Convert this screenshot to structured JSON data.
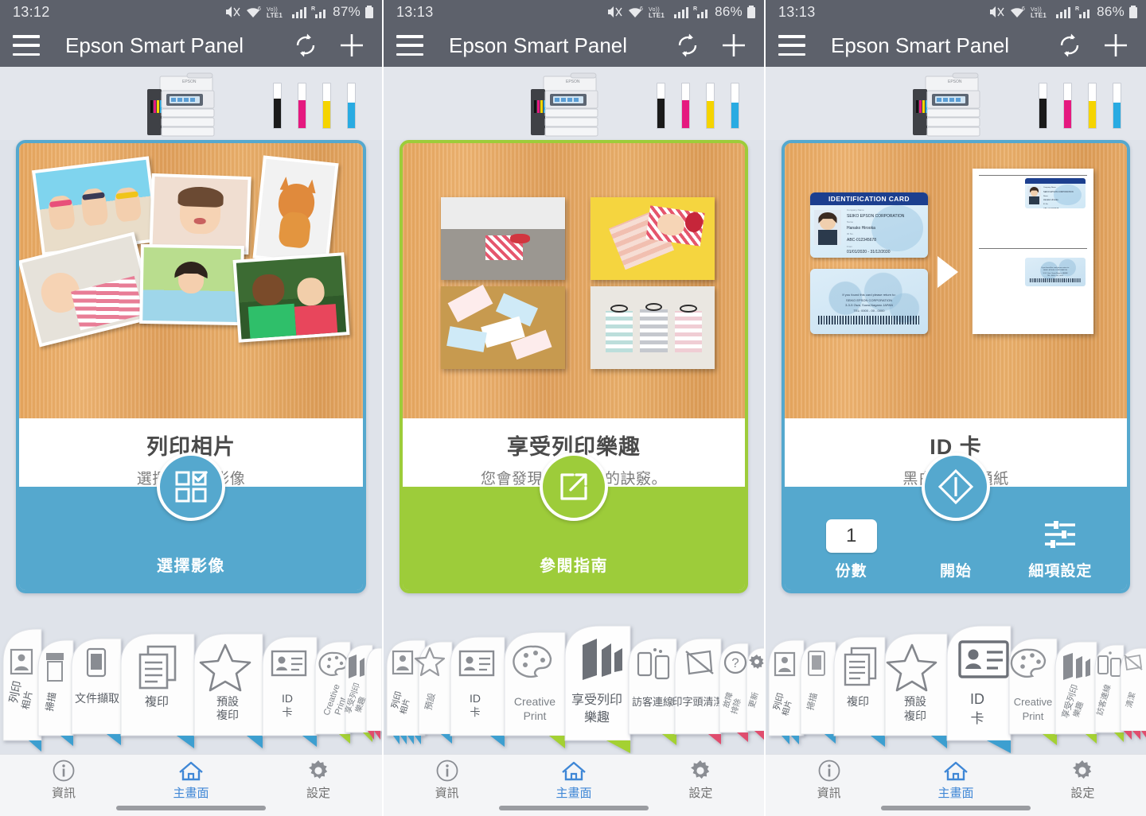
{
  "panels": [
    {
      "status": {
        "time": "13:12",
        "battery": "87%",
        "network": "LTE1",
        "voice": "Vo)) ",
        "mute_icon": "mute-icon",
        "wifi_icon": "wifi-icon",
        "signal_icon": "signal-icon",
        "battery_icon": "battery-icon"
      },
      "appbar": {
        "menu_icon": "hamburger-menu-icon",
        "title": "Epson Smart Panel",
        "refresh_icon": "refresh-icon",
        "add_icon": "plus-icon"
      },
      "printer": {
        "brand": "EPSON",
        "ink_colors": [
          "#1a1a1a",
          "#e5197f",
          "#f5d400",
          "#29abe2"
        ]
      },
      "card": {
        "accent": "#55a8ce",
        "title": "列印相片",
        "subtitle": "選擇並列印影像",
        "action_icon": "select-images-grid-icon",
        "action_label": "選擇影像"
      },
      "carousel": [
        {
          "label_lines": [
            "列印",
            "相片"
          ],
          "icon": "photo-print-icon",
          "tab_color": "#3c9fd0",
          "state": "far-left"
        },
        {
          "label_lines": [
            "掃描"
          ],
          "icon": "scan-icon",
          "tab_color": "#3c9fd0",
          "state": "small"
        },
        {
          "label_lines": [
            "文件擷取"
          ],
          "icon": "document-capture-icon",
          "tab_color": "#3c9fd0",
          "state": "small"
        },
        {
          "label_lines": [
            "複印"
          ],
          "icon": "copy-icon",
          "tab_color": "#3c9fd0",
          "state": "normal"
        },
        {
          "label_lines": [
            "預設",
            "複印"
          ],
          "icon": "star-icon",
          "tab_color": "#3c9fd0",
          "state": "normal"
        },
        {
          "label_lines": [
            "ID",
            "卡"
          ],
          "icon": "id-card-icon",
          "tab_color": "#3c9fd0",
          "state": "normal"
        },
        {
          "label_lines": [
            "Creative",
            "Print"
          ],
          "icon": "palette-icon",
          "tab_color": "#a4d133",
          "state": "small"
        },
        {
          "label_lines": [
            "享受列印",
            "樂趣"
          ],
          "icon": "enjoy-print-icon",
          "tab_color": "#a4d133",
          "state": "small"
        },
        {
          "label_lines": [
            ""
          ],
          "icon": "stack-icon",
          "tab_color": "#e04e6e",
          "state": "stack"
        }
      ],
      "bottomnav": [
        {
          "label": "資訊",
          "icon": "info-icon",
          "active": false
        },
        {
          "label": "主畫面",
          "icon": "home-icon",
          "active": true
        },
        {
          "label": "設定",
          "icon": "gear-icon",
          "active": false
        }
      ]
    },
    {
      "status": {
        "time": "13:13",
        "battery": "86%",
        "network": "LTE1"
      },
      "appbar": {
        "title": "Epson Smart Panel"
      },
      "card": {
        "accent": "#9dcc3a",
        "title": "享受列印樂趣",
        "subtitle": "您會發現更多有趣的訣竅。",
        "action_icon": "external-link-icon",
        "action_label": "參閱指南"
      },
      "carousel": [
        {
          "label_lines": [
            "列印",
            "相片"
          ],
          "icon": "photo-print-icon",
          "tab_color": "#3c9fd0",
          "state": "stack"
        },
        {
          "label_lines": [
            "預設",
            "複印"
          ],
          "icon": "star-icon",
          "tab_color": "#3c9fd0",
          "state": "small"
        },
        {
          "label_lines": [
            "ID",
            "卡"
          ],
          "icon": "id-card-icon",
          "tab_color": "#3c9fd0",
          "state": "normal"
        },
        {
          "label_lines": [
            "Creative",
            "Print"
          ],
          "icon": "palette-icon",
          "tab_color": "#a4d133",
          "state": "normal"
        },
        {
          "label_lines": [
            "享受列印",
            "樂趣"
          ],
          "icon": "enjoy-print-icon",
          "tab_color": "#a4d133",
          "state": "active"
        },
        {
          "label_lines": [
            "訪客連線"
          ],
          "icon": "guest-connect-icon",
          "tab_color": "#a4d133",
          "state": "normal"
        },
        {
          "label_lines": [
            "印字頭清潔"
          ],
          "icon": "head-cleaning-icon",
          "tab_color": "#e04e6e",
          "state": "normal"
        },
        {
          "label_lines": [
            "故障",
            "排除"
          ],
          "icon": "question-icon",
          "tab_color": "#e04e6e",
          "state": "small"
        },
        {
          "label_lines": [
            "更新"
          ],
          "icon": "gear-update-icon",
          "tab_color": "#e04e6e",
          "state": "small"
        }
      ],
      "bottomnav": [
        {
          "label": "資訊",
          "icon": "info-icon",
          "active": false
        },
        {
          "label": "主畫面",
          "icon": "home-icon",
          "active": true
        },
        {
          "label": "設定",
          "icon": "gear-icon",
          "active": false
        }
      ]
    },
    {
      "status": {
        "time": "13:13",
        "battery": "86%",
        "network": "LTE1"
      },
      "appbar": {
        "title": "Epson Smart Panel"
      },
      "card": {
        "accent": "#55a8ce",
        "title": "ID 卡",
        "subtitle": "黑白/A4/普通紙",
        "action_icon": "start-diamond-icon",
        "copies_value": "1",
        "copies_label": "份數",
        "start_label": "開始",
        "settings_icon": "sliders-icon",
        "settings_label": "細項設定"
      },
      "id_card": {
        "front_header": "IDENTIFICATION CARD",
        "front_fields": [
          {
            "key": "Company Name",
            "value": "SEIKO EPSON CORPORATION"
          },
          {
            "key": "Name",
            "value": "Hanako Hirooka"
          },
          {
            "key": "ID No.",
            "value": "ABC-012345678"
          },
          {
            "key": "From",
            "value": "01/01/2020 - 31/12/2030"
          }
        ],
        "back_lines": [
          "If you found this card please return to:",
          "SEIKO EPSON CORPORATION",
          "3-3-5 Owa, Suwa,Nagano JAPAN",
          "TEL: 0000 - 00 - 0000"
        ]
      },
      "carousel": [
        {
          "label_lines": [
            "列印",
            "相片"
          ],
          "icon": "photo-print-icon",
          "tab_color": "#3c9fd0",
          "state": "stack"
        },
        {
          "label_lines": [
            "掃描"
          ],
          "icon": "scan-icon",
          "tab_color": "#3c9fd0",
          "state": "small"
        },
        {
          "label_lines": [
            "複印"
          ],
          "icon": "copy-icon",
          "tab_color": "#3c9fd0",
          "state": "normal"
        },
        {
          "label_lines": [
            "預設",
            "複印"
          ],
          "icon": "star-icon",
          "tab_color": "#3c9fd0",
          "state": "normal"
        },
        {
          "label_lines": [
            "ID",
            "卡"
          ],
          "icon": "id-card-icon",
          "tab_color": "#3c9fd0",
          "state": "active"
        },
        {
          "label_lines": [
            "Creative",
            "Print"
          ],
          "icon": "palette-icon",
          "tab_color": "#a4d133",
          "state": "normal"
        },
        {
          "label_lines": [
            "享受列印",
            "樂趣"
          ],
          "icon": "enjoy-print-icon",
          "tab_color": "#a4d133",
          "state": "normal"
        },
        {
          "label_lines": [
            "訪客連線"
          ],
          "icon": "guest-connect-icon",
          "tab_color": "#a4d133",
          "state": "small"
        },
        {
          "label_lines": [
            "清潔"
          ],
          "icon": "head-cleaning-icon",
          "tab_color": "#e04e6e",
          "state": "stack"
        }
      ],
      "bottomnav": [
        {
          "label": "資訊",
          "icon": "info-icon",
          "active": false
        },
        {
          "label": "主畫面",
          "icon": "home-icon",
          "active": true
        },
        {
          "label": "設定",
          "icon": "gear-icon",
          "active": false
        }
      ]
    }
  ]
}
